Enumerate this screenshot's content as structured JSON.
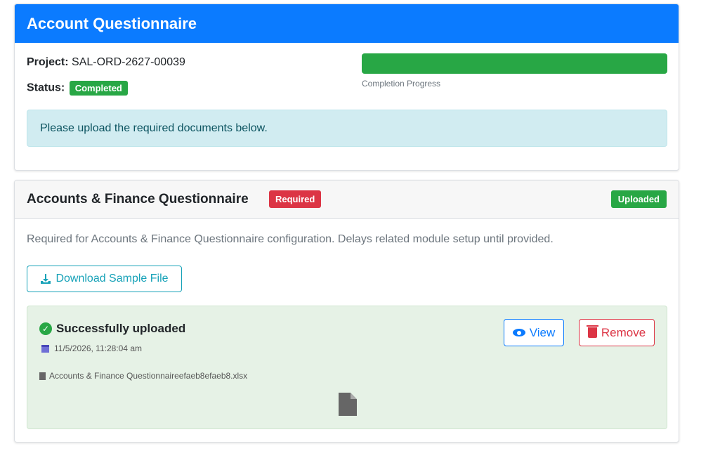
{
  "header": {
    "title": "Account Questionnaire"
  },
  "project": {
    "label": "Project:",
    "value": "SAL-ORD-2627-00039"
  },
  "status": {
    "label": "Status:",
    "value": "Completed"
  },
  "progress": {
    "percent": 100,
    "label": "Completion Progress"
  },
  "info_alert": "Please upload the required documents below.",
  "section": {
    "title": "Accounts & Finance Questionnaire",
    "required_badge": "Required",
    "uploaded_badge": "Uploaded",
    "description": "Required for Accounts & Finance Questionnaire configuration. Delays related module setup until provided.",
    "download_label": "Download Sample File",
    "upload": {
      "title": "Successfully uploaded",
      "datetime": "11/5/2026, 11:28:04 am",
      "filename": "Accounts & Finance Questionnaireefaeb8efaeb8.xlsx",
      "view_label": "View",
      "remove_label": "Remove"
    }
  },
  "colors": {
    "primary": "#0b7bff",
    "success": "#28a745",
    "danger": "#dc3545",
    "info": "#17a2b8"
  },
  "icons": [
    "download-icon",
    "check-circle-icon",
    "calendar-icon",
    "file-icon",
    "eye-icon",
    "trash-icon"
  ]
}
